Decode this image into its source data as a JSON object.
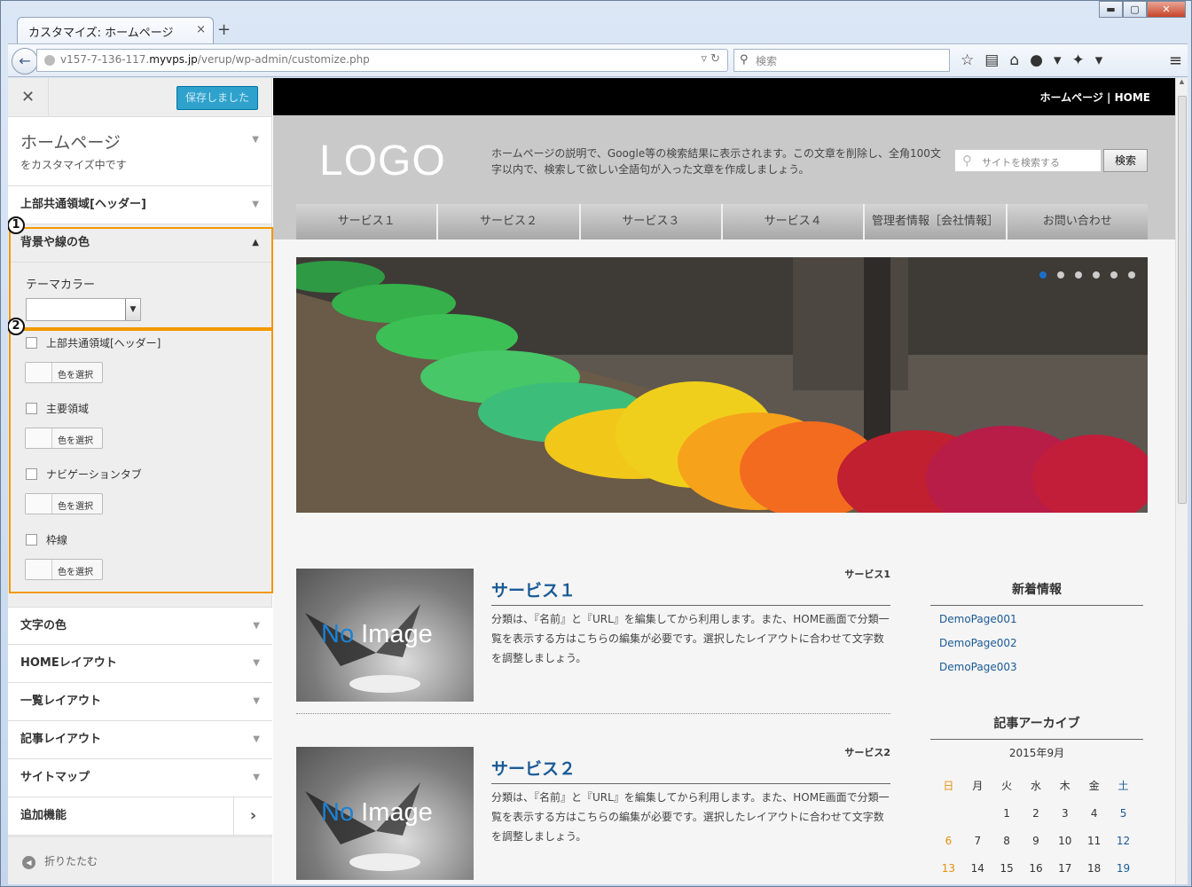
{
  "browser": {
    "tab_title": "カスタマイズ: ホームページ",
    "tab_close": "×",
    "new_tab": "+",
    "url_prefix": "v157-7-136-117.",
    "url_host": "myvps.jp",
    "url_path": "/verup/wp-admin/customize.php",
    "search_placeholder": "検索",
    "win_min": "▬",
    "win_max": "▢",
    "win_close": "✕"
  },
  "customizer": {
    "close": "✕",
    "save_label": "保存しました",
    "panel_title": "ホームページ",
    "panel_subtitle": "をカスタマイズ中です",
    "sections": [
      {
        "label": "上部共通領域[ヘッダー]"
      },
      {
        "label": "背景や線の色"
      },
      {
        "label": "文字の色"
      },
      {
        "label": "HOMEレイアウト"
      },
      {
        "label": "一覧レイアウト"
      },
      {
        "label": "記事レイアウト"
      },
      {
        "label": "サイトマップ"
      },
      {
        "label": "追加機能"
      }
    ],
    "marker1": "1",
    "marker2": "2",
    "theme_color_label": "テーマカラー",
    "checkboxes": [
      {
        "label": "上部共通領域[ヘッダー]",
        "button": "色を選択"
      },
      {
        "label": "主要領域",
        "button": "色を選択"
      },
      {
        "label": "ナビゲーションタブ",
        "button": "色を選択"
      },
      {
        "label": "枠線",
        "button": "色を選択"
      }
    ],
    "collapse_label": "折りたたむ"
  },
  "site": {
    "top_link": "ホームページ | HOME",
    "logo": "LOGO",
    "description": "ホームページの説明で、Google等の検索結果に表示されます。この文章を削除し、全角100文字以内で、検索して欲しい全語句が入った文章を作成しましょう。",
    "search_placeholder": "サイトを検索する",
    "search_button": "検索",
    "nav": [
      "サービス１",
      "サービス２",
      "サービス３",
      "サービス４",
      "管理者情報［会社情報］",
      "お問い合わせ"
    ],
    "posts": [
      {
        "category": "サービス1",
        "title": "サービス１",
        "body": "分類は、『名前』と『URL』を編集してから利用します。また、HOME画面で分類一覧を表示する方はこちらの編集が必要です。選択したレイアウトに合わせて文字数を調整しましょう。",
        "thumb_no": "No",
        "thumb_image": " Image"
      },
      {
        "category": "サービス2",
        "title": "サービス２",
        "body": "分類は、『名前』と『URL』を編集してから利用します。また、HOME画面で分類一覧を表示する方はこちらの編集が必要です。選択したレイアウトに合わせて文字数を調整しましょう。",
        "thumb_no": "No",
        "thumb_image": " Image"
      }
    ],
    "news_title": "新着情報",
    "news_links": [
      "DemoPage001",
      "DemoPage002",
      "DemoPage003"
    ],
    "archive_title": "記事アーカイブ",
    "calendar_caption": "2015年9月",
    "calendar_days": [
      "日",
      "月",
      "火",
      "水",
      "木",
      "金",
      "土"
    ],
    "calendar_rows": [
      [
        "",
        "",
        "1",
        "2",
        "3",
        "4",
        "5"
      ],
      [
        "6",
        "7",
        "8",
        "9",
        "10",
        "11",
        "12"
      ],
      [
        "13",
        "14",
        "15",
        "16",
        "17",
        "18",
        "19"
      ]
    ]
  }
}
